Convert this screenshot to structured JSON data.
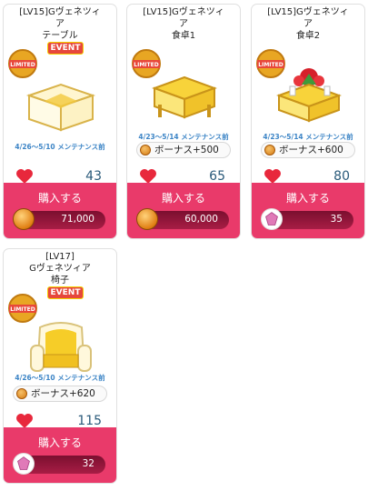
{
  "cards": [
    {
      "title_line1": "[LV15]Gヴェネツィ",
      "title_line2": "ア",
      "title_line3": "テーブル",
      "event": "EVENT",
      "limited": "LIMITED",
      "period": "4/26～5/10 メンテナンス前",
      "bonus": "",
      "likes": "43",
      "buy_label": "購入する",
      "price": "71,000",
      "currency": "coin",
      "item_icon": "glass-table"
    },
    {
      "title_line1": "[LV15]Gヴェネツィ",
      "title_line2": "ア",
      "title_line3": "食卓1",
      "event": "",
      "limited": "LIMITED",
      "period": "4/23～5/14 メンテナンス前",
      "bonus": "ボーナス+500",
      "likes": "65",
      "buy_label": "購入する",
      "price": "60,000",
      "currency": "coin",
      "item_icon": "gold-table"
    },
    {
      "title_line1": "[LV15]Gヴェネツィ",
      "title_line2": "ア",
      "title_line3": "食卓2",
      "event": "",
      "limited": "LIMITED",
      "period": "4/23～5/14 メンテナンス前",
      "bonus": "ボーナス+600",
      "likes": "80",
      "buy_label": "購入する",
      "price": "35",
      "currency": "gem",
      "item_icon": "table-with-roses"
    },
    {
      "title_line1": "[LV17]",
      "title_line2": "Gヴェネツィア",
      "title_line3": "椅子",
      "event": "EVENT",
      "limited": "LIMITED",
      "period": "4/26～5/10 メンテナンス前",
      "bonus": "ボーナス+620",
      "likes": "115",
      "buy_label": "購入する",
      "price": "32",
      "currency": "gem",
      "item_icon": "gold-armchair"
    }
  ],
  "colors": {
    "buy_bg": "#e93a6a",
    "price_bar": "#8e1536",
    "period_text": "#3d85c6",
    "heart": "#e8283c"
  }
}
